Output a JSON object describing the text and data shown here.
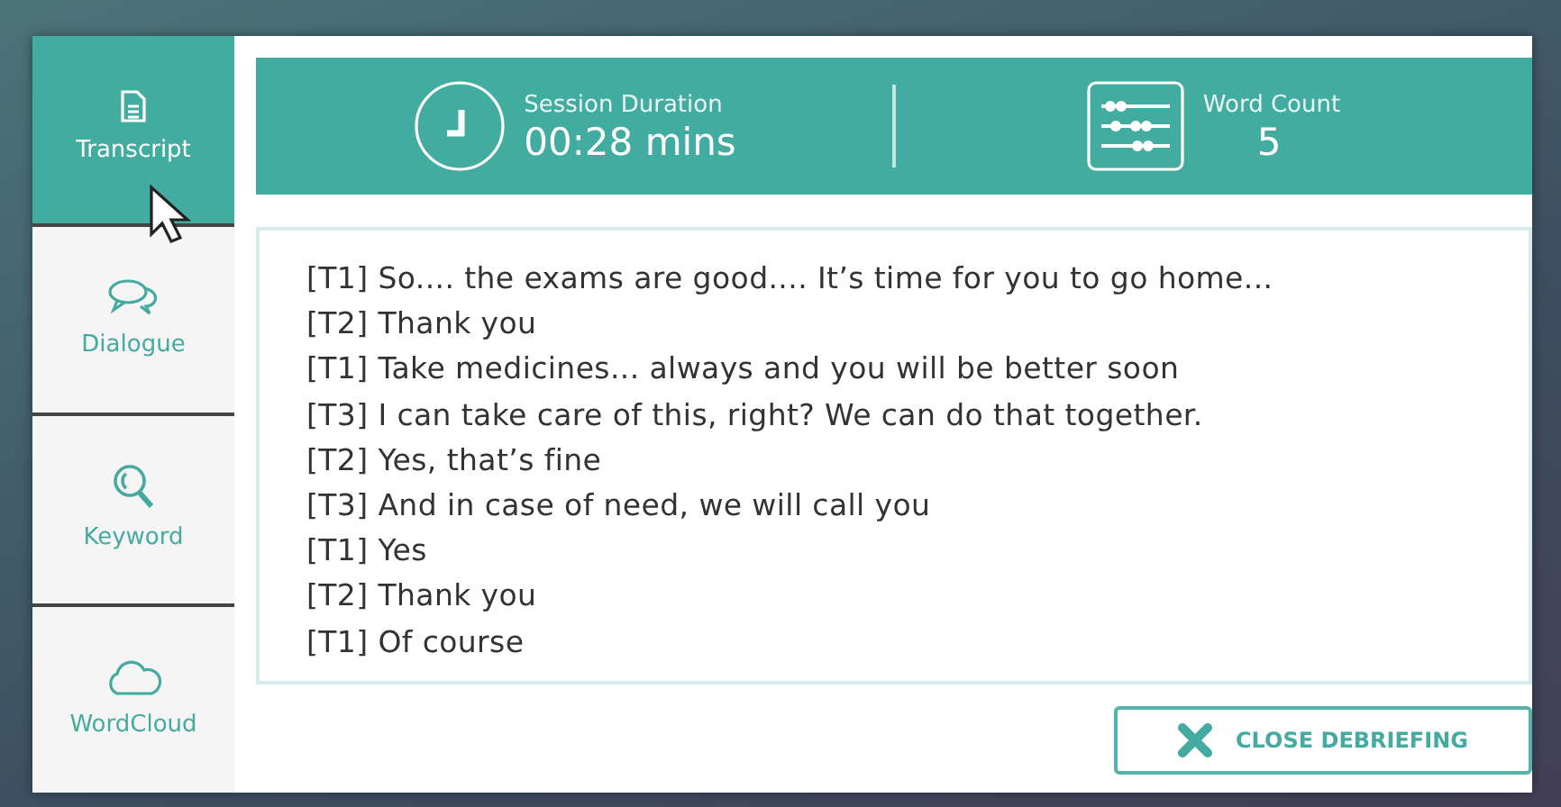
{
  "sidebar": {
    "items": [
      {
        "label": "Transcript",
        "selected": true
      },
      {
        "label": "Dialogue",
        "selected": false
      },
      {
        "label": "Keyword",
        "selected": false
      },
      {
        "label": "WordCloud",
        "selected": false
      }
    ]
  },
  "stats": [
    {
      "label": "Session Duration",
      "value": "00:28 mins"
    },
    {
      "label": "Word Count",
      "value": "5"
    }
  ],
  "transcript": [
    "[T1] So.... the exams are good.... It’s time for you to go home...",
    "[T2] Thank you",
    "[T1] Take medicines... always and you will be better soon",
    "[T3] I can take care of this, right? We can do that together.",
    "[T2] Yes, that’s fine",
    "[T3] And in case of need, we will call you",
    "[T1] Yes",
    "[T2] Thank you",
    "[T1] Of course"
  ],
  "close_button": {
    "label": "CLOSE DEBRIEFING"
  }
}
